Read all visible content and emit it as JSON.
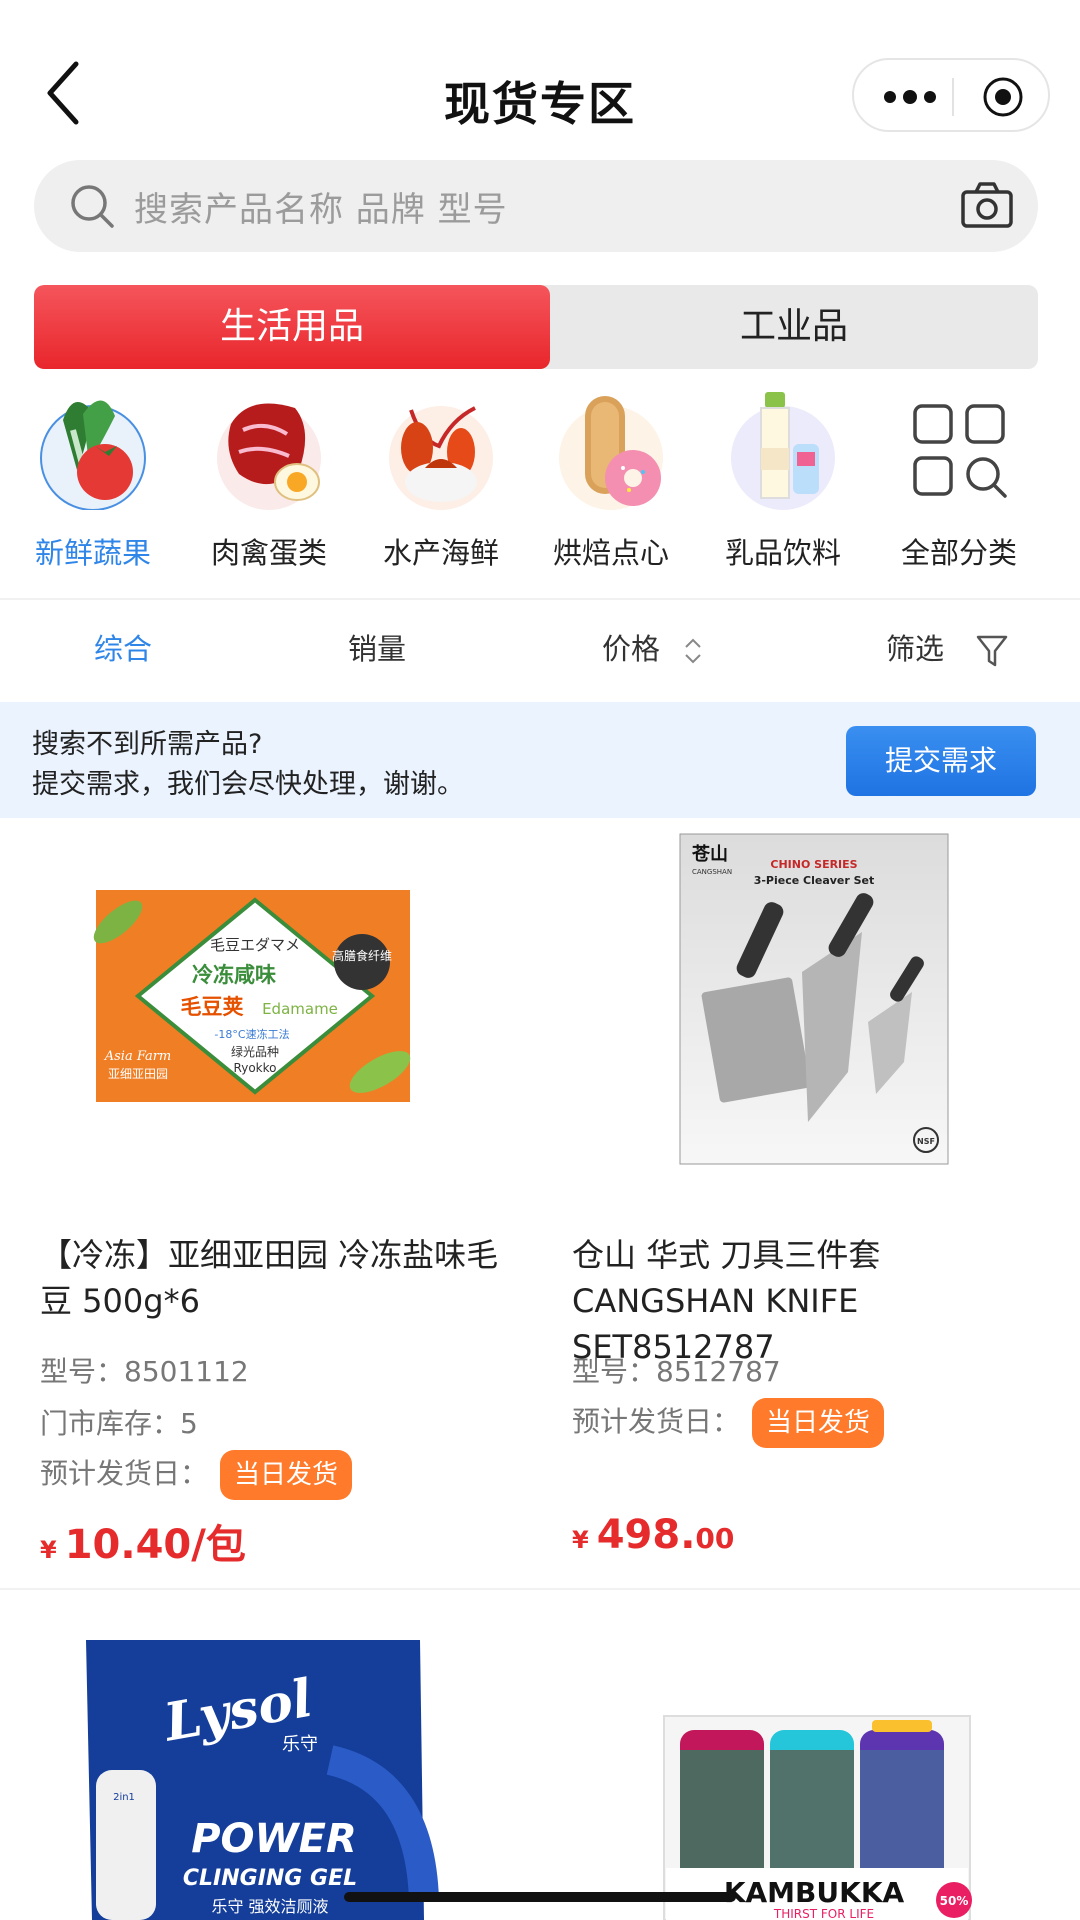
{
  "header": {
    "title": "现货专区"
  },
  "search": {
    "placeholder": "搜索产品名称 品牌 型号"
  },
  "segment": {
    "tabs": [
      {
        "label": "生活用品",
        "active": true
      },
      {
        "label": "工业品",
        "active": false
      }
    ]
  },
  "categories": [
    {
      "label": "新鲜蔬果",
      "icon": "vegetables-icon",
      "selected": true
    },
    {
      "label": "肉禽蛋类",
      "icon": "meat-egg-icon",
      "selected": false
    },
    {
      "label": "水产海鲜",
      "icon": "lobster-icon",
      "selected": false
    },
    {
      "label": "烘焙点心",
      "icon": "bread-donut-icon",
      "selected": false
    },
    {
      "label": "乳品饮料",
      "icon": "milk-drink-icon",
      "selected": false
    },
    {
      "label": "全部分类",
      "icon": "grid-search-icon",
      "selected": false
    }
  ],
  "sort": {
    "items": [
      "综合",
      "销量",
      "价格",
      "筛选"
    ],
    "active": "综合"
  },
  "notice": {
    "line1": "搜索不到所需产品?",
    "line2": "提交需求，我们会尽快处理，谢谢。",
    "button": "提交需求"
  },
  "products": [
    {
      "name": "【冷冻】亚细亚田园 冷冻盐味毛豆 500g*6",
      "model": "型号：8501112",
      "stock": "门市库存：5",
      "ship_label": "预计发货日：",
      "ship_badge": "当日发货",
      "price_currency": "¥",
      "price_main": "10.40/包",
      "price_decimal": "",
      "image_texts": [
        "毛豆エダマメ",
        "冷冻咸味",
        "毛豆荚",
        "Edamame",
        "高膳食纤维",
        "-18°C速冻工法",
        "绿光品种",
        "Ryokko",
        "Asia Farm",
        "亚细亚田园"
      ]
    },
    {
      "name": "仓山 华式 刀具三件套 CANGSHAN KNIFE SET8512787",
      "model": "型号：8512787",
      "stock": "",
      "ship_label": "预计发货日：",
      "ship_badge": "当日发货",
      "price_currency": "¥",
      "price_main": "498.",
      "price_decimal": "00",
      "image_texts": [
        "苍山",
        "CANGSHAN",
        "CHINO SERIES",
        "3-Piece Cleaver Set",
        "NSF"
      ]
    },
    {
      "name": "",
      "image_texts": [
        "Lysol",
        "乐守",
        "POWER",
        "CLINGING GEL",
        "乐守 强效洁厕液",
        "2in1"
      ]
    },
    {
      "name": "",
      "image_texts": [
        "KAMBUKKA",
        "THIRST FOR LIFE",
        "50%"
      ]
    }
  ],
  "colors": {
    "accent_red": "#e8262b",
    "accent_blue": "#2f86e8",
    "badge_orange": "#ff7a2a",
    "price_red": "#e52b2b"
  }
}
